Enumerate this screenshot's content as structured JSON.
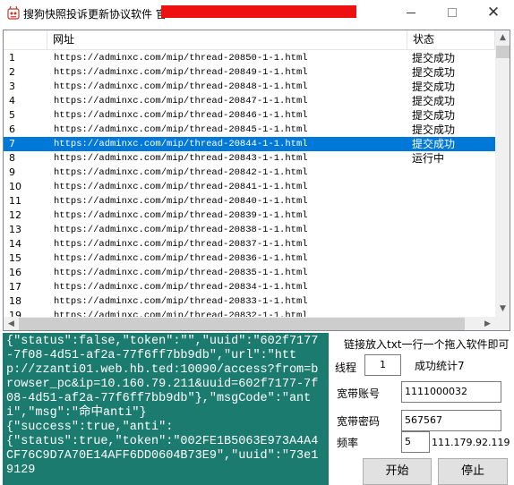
{
  "window": {
    "title": "搜狗快照投诉更新协议软件 官"
  },
  "list": {
    "columns": [
      "",
      "网址",
      "状态"
    ],
    "rows": [
      {
        "no": "1",
        "url": "https://adminxc.com/mip/thread-20850-1-1.html",
        "status": "提交成功"
      },
      {
        "no": "2",
        "url": "https://adminxc.com/mip/thread-20849-1-1.html",
        "status": "提交成功"
      },
      {
        "no": "3",
        "url": "https://adminxc.com/mip/thread-20848-1-1.html",
        "status": "提交成功"
      },
      {
        "no": "4",
        "url": "https://adminxc.com/mip/thread-20847-1-1.html",
        "status": "提交成功"
      },
      {
        "no": "5",
        "url": "https://adminxc.com/mip/thread-20846-1-1.html",
        "status": "提交成功"
      },
      {
        "no": "6",
        "url": "https://adminxc.com/mip/thread-20845-1-1.html",
        "status": "提交成功"
      },
      {
        "no": "7",
        "url": "https://adminxc.com/mip/thread-20844-1-1.html",
        "status": "提交成功",
        "selected": true
      },
      {
        "no": "8",
        "url": "https://adminxc.com/mip/thread-20843-1-1.html",
        "status": "运行中"
      },
      {
        "no": "9",
        "url": "https://adminxc.com/mip/thread-20842-1-1.html",
        "status": ""
      },
      {
        "no": "10",
        "url": "https://adminxc.com/mip/thread-20841-1-1.html",
        "status": ""
      },
      {
        "no": "11",
        "url": "https://adminxc.com/mip/thread-20840-1-1.html",
        "status": ""
      },
      {
        "no": "12",
        "url": "https://adminxc.com/mip/thread-20839-1-1.html",
        "status": ""
      },
      {
        "no": "13",
        "url": "https://adminxc.com/mip/thread-20838-1-1.html",
        "status": ""
      },
      {
        "no": "14",
        "url": "https://adminxc.com/mip/thread-20837-1-1.html",
        "status": ""
      },
      {
        "no": "15",
        "url": "https://adminxc.com/mip/thread-20836-1-1.html",
        "status": ""
      },
      {
        "no": "16",
        "url": "https://adminxc.com/mip/thread-20835-1-1.html",
        "status": ""
      },
      {
        "no": "17",
        "url": "https://adminxc.com/mip/thread-20834-1-1.html",
        "status": ""
      },
      {
        "no": "18",
        "url": "https://adminxc.com/mip/thread-20833-1-1.html",
        "status": ""
      },
      {
        "no": "19",
        "url": "https://adminxc.com/mip/thread-20832-1-1.html",
        "status": ""
      }
    ]
  },
  "log": {
    "text": "{\"status\":false,\"token\":\"\",\"uuid\":\"602f7177-7f08-4d51-af2a-77f6ff7bb9db\",\"url\":\"http://zzanti01.web.hb.ted:10090/access?from=browser_pc&ip=10.160.79.211&uuid=602f7177-7f08-4d51-af2a-77f6ff7bb9db\"},\"msgCode\":\"anti\",\"msg\":\"命中anti\"}\n{\"success\":true,\"anti\":\n{\"status\":true,\"token\":\"002FE1B5063E973A4A4CF76C9D7A70E14AFF6DD0604B73E9\",\"uuid\":\"73e19129"
  },
  "controls": {
    "hint": "链接放入txt一行一个拖入软件即可",
    "threads_label": "线程",
    "threads_value": "1",
    "success_label": "成功统计7",
    "account_label": "宽带账号",
    "account_value": "1111000032",
    "password_label": "宽带密码",
    "password_value": "567567",
    "rate_label": "频率",
    "rate_value": "5",
    "ip_text": "111.179.92.119",
    "start_label": "开始",
    "stop_label": "停止"
  },
  "colors": {
    "selection": "#0078d7",
    "log_bg": "#1b7b6f",
    "title_redact": "#ee1111"
  }
}
